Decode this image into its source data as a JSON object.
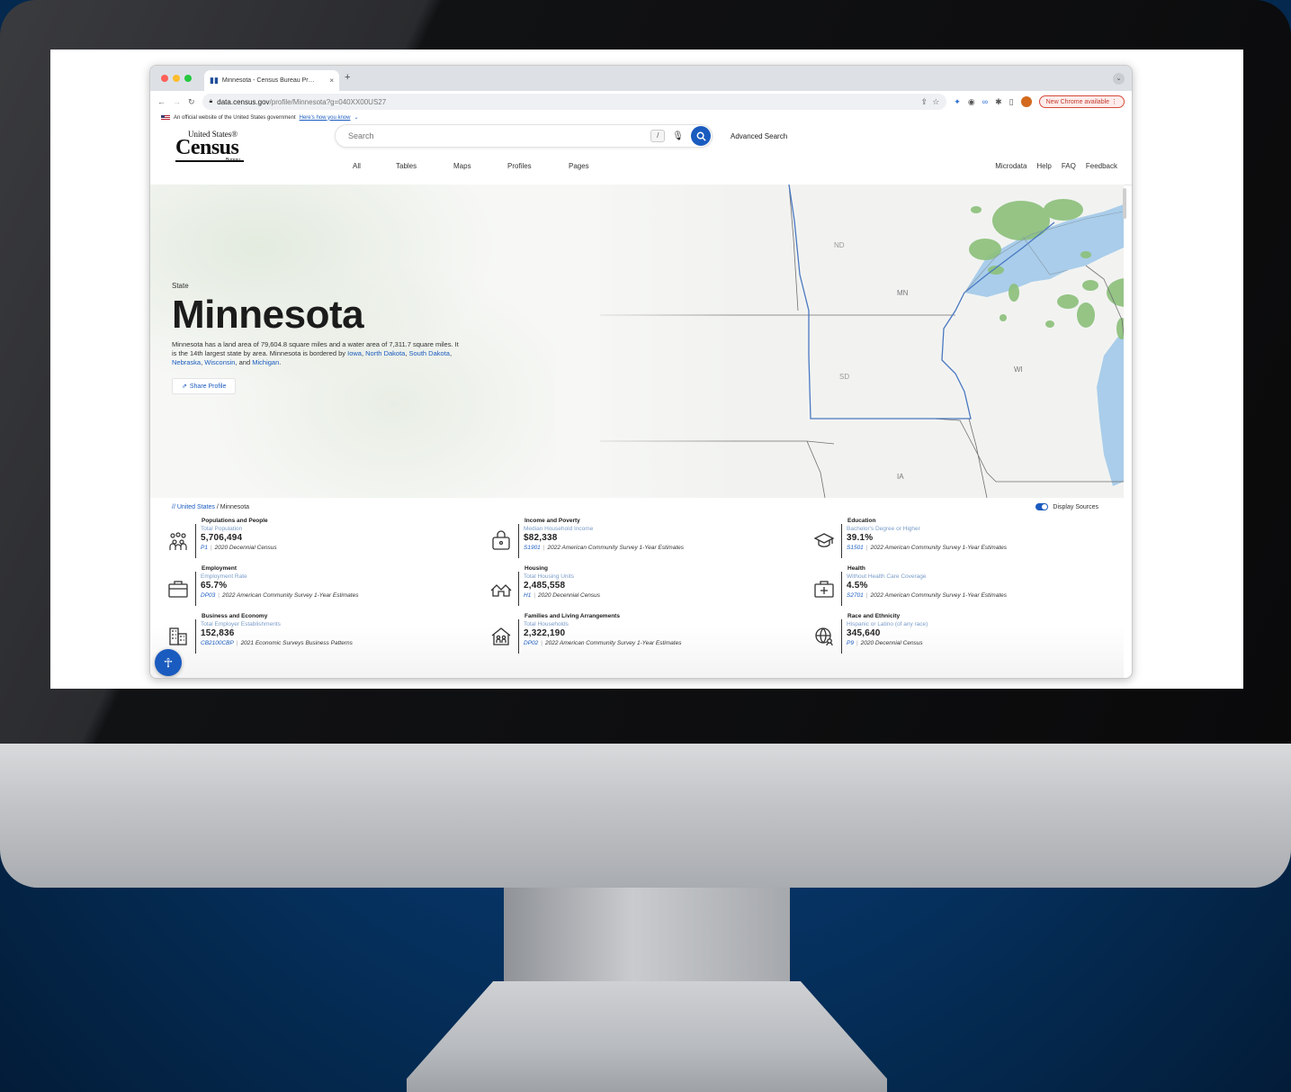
{
  "browser": {
    "tab_title": "Minnesota - Census Bureau Pr…",
    "tab_close": "×",
    "new_tab": "+",
    "url_domain": "data.census.gov",
    "url_path": "/profile/Minnesota?g=040XX00US27",
    "update_badge": "New Chrome available",
    "tab_menu": "⌄"
  },
  "gov_banner": {
    "text": "An official website of the United States government",
    "link": "Here's how you know"
  },
  "logo": {
    "line1": "United States®",
    "line2": "Census",
    "line3": "Bureau"
  },
  "search": {
    "placeholder": "Search",
    "shortcut": "/",
    "advanced": "Advanced Search"
  },
  "nav": {
    "left": [
      "All",
      "Tables",
      "Maps",
      "Profiles",
      "Pages"
    ],
    "right": [
      "Microdata",
      "Help",
      "FAQ",
      "Feedback"
    ]
  },
  "map_labels": [
    "ND",
    "MN",
    "SD",
    "WI",
    "IA"
  ],
  "hero": {
    "kicker": "State",
    "title": "Minnesota",
    "desc_prefix": "Minnesota has a land area of 79,604.8 square miles and a water area of 7,311.7 square miles. It is the 14th largest state by area. Minnesota is bordered by ",
    "bordering": [
      "Iowa",
      "North Dakota",
      "South Dakota",
      "Nebraska",
      "Wisconsin",
      "Michigan"
    ],
    "share": "Share Profile"
  },
  "breadcrumb": {
    "root": "//",
    "parent": "United States",
    "sep": "/",
    "current": "Minnesota"
  },
  "display_sources": "Display Sources",
  "stats": [
    {
      "category": "Populations and People",
      "metric": "Total Population",
      "value": "5,706,494",
      "code": "P1",
      "source": "2020 Decennial Census",
      "icon": "people-icon"
    },
    {
      "category": "Income and Poverty",
      "metric": "Median Household Income",
      "value": "$82,338",
      "code": "S1901",
      "source": "2022 American Community Survey 1-Year Estimates",
      "icon": "wallet-icon"
    },
    {
      "category": "Education",
      "metric": "Bachelor's Degree or Higher",
      "value": "39.1%",
      "code": "S1501",
      "source": "2022 American Community Survey 1-Year Estimates",
      "icon": "graduation-cap-icon"
    },
    {
      "category": "Employment",
      "metric": "Employment Rate",
      "value": "65.7%",
      "code": "DP03",
      "source": "2022 American Community Survey 1-Year Estimates",
      "icon": "briefcase-icon"
    },
    {
      "category": "Housing",
      "metric": "Total Housing Units",
      "value": "2,485,558",
      "code": "H1",
      "source": "2020 Decennial Census",
      "icon": "houses-icon"
    },
    {
      "category": "Health",
      "metric": "Without Health Care Coverage",
      "value": "4.5%",
      "code": "S2701",
      "source": "2022 American Community Survey 1-Year Estimates",
      "icon": "medical-kit-icon"
    },
    {
      "category": "Business and Economy",
      "metric": "Total Employer Establishments",
      "value": "152,836",
      "code": "CB2100CBP",
      "source": "2021 Economic Surveys Business Patterns",
      "icon": "buildings-icon"
    },
    {
      "category": "Families and Living Arrangements",
      "metric": "Total Households",
      "value": "2,322,190",
      "code": "DP02",
      "source": "2022 American Community Survey 1-Year Estimates",
      "icon": "family-home-icon"
    },
    {
      "category": "Race and Ethnicity",
      "metric": "Hispanic or Latino (of any race)",
      "value": "345,640",
      "code": "P9",
      "source": "2020 Decennial Census",
      "icon": "globe-people-icon"
    }
  ],
  "colors": {
    "accent": "#1a5bbf",
    "background": "#04294f",
    "update_red": "#c43b2d",
    "land_green": "#8cc07a",
    "water_blue": "#a9cdea"
  }
}
